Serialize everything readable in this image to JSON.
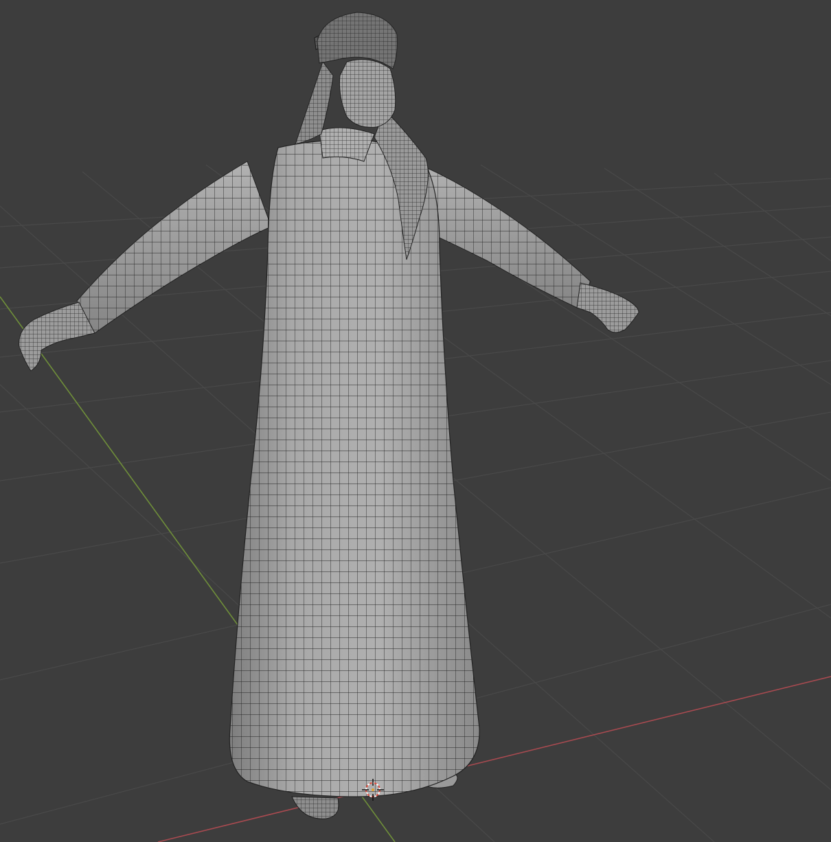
{
  "app": {
    "name": "3D Viewport",
    "shading": "solid-wireframe"
  },
  "scene": {
    "model": "thobe-ghutra-character-mesh",
    "pose": "t-pose"
  },
  "colors": {
    "background": "#3d3d3d",
    "grid": "#4a4a4a",
    "x_axis": "#a84a50",
    "y_axis": "#6f8f3a",
    "mesh_fill": "#a3a3a3",
    "mesh_wire": "#1e1e1e",
    "cursor_red": "#e04a3a"
  },
  "icons": {
    "cursor": "3d-cursor-icon"
  }
}
